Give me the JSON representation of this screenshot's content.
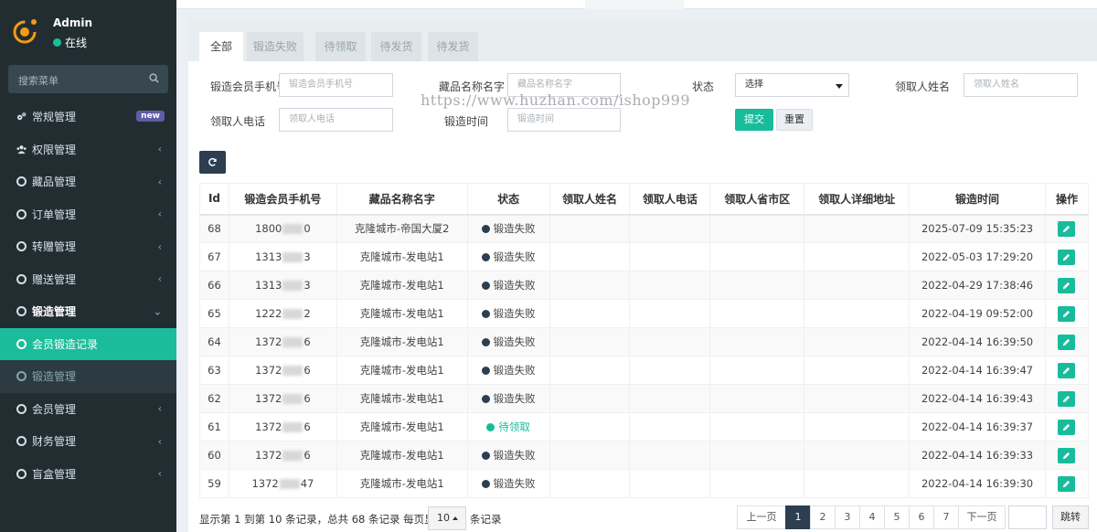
{
  "sidebar": {
    "user": {
      "name": "Admin",
      "status": "在线"
    },
    "search_placeholder": "搜索菜单",
    "items": [
      {
        "label": "常规管理",
        "icon": "gears-icon",
        "badge": "new"
      },
      {
        "label": "权限管理",
        "icon": "group-icon"
      },
      {
        "label": "藏品管理",
        "icon": "circle-icon"
      },
      {
        "label": "订单管理",
        "icon": "circle-icon"
      },
      {
        "label": "转赠管理",
        "icon": "circle-icon"
      },
      {
        "label": "赠送管理",
        "icon": "circle-icon"
      },
      {
        "label": "锻造管理",
        "icon": "circle-icon",
        "open": true
      },
      {
        "label": "会员锻造记录",
        "icon": "circle-icon",
        "sub": true,
        "active": true
      },
      {
        "label": "锻造管理",
        "icon": "circle-icon",
        "sub": true
      },
      {
        "label": "会员管理",
        "icon": "circle-icon"
      },
      {
        "label": "财务管理",
        "icon": "circle-icon"
      },
      {
        "label": "盲盒管理",
        "icon": "circle-icon"
      }
    ]
  },
  "tabs": [
    "全部",
    "锻造失败",
    "待领取",
    "待发货",
    "待发货"
  ],
  "filters": {
    "phone_label": "锻造会员手机号",
    "phone_placeholder": "锻造会员手机号",
    "item_label": "藏品名称名字",
    "item_placeholder": "藏品名称名字",
    "status_label": "状态",
    "status_value": "选择",
    "receiver_label": "领取人姓名",
    "receiver_placeholder": "领取人姓名",
    "receiver_phone_label": "领取人电话",
    "receiver_phone_placeholder": "领取人电话",
    "time_label": "锻造时间",
    "time_placeholder": "锻造时间",
    "submit": "提交",
    "reset": "重置"
  },
  "watermark": "https://www.huzhan.com/ishop999",
  "table": {
    "headers": [
      "Id",
      "锻造会员手机号",
      "藏品名称名字",
      "状态",
      "领取人姓名",
      "领取人电话",
      "领取人省市区",
      "领取人详细地址",
      "锻造时间",
      "操作"
    ],
    "rows": [
      {
        "id": "68",
        "phone_a": "1800",
        "phone_b": "0",
        "item": "克隆城市-帝国大厦2",
        "status": "锻造失败",
        "status_color": "#2c3e50",
        "time": "2025-07-09 15:35:23"
      },
      {
        "id": "67",
        "phone_a": "1313",
        "phone_b": "3",
        "item": "克隆城市-发电站1",
        "status": "锻造失败",
        "status_color": "#2c3e50",
        "time": "2022-05-03 17:29:20"
      },
      {
        "id": "66",
        "phone_a": "1313",
        "phone_b": "3",
        "item": "克隆城市-发电站1",
        "status": "锻造失败",
        "status_color": "#2c3e50",
        "time": "2022-04-29 17:38:46"
      },
      {
        "id": "65",
        "phone_a": "1222",
        "phone_b": "2",
        "item": "克隆城市-发电站1",
        "status": "锻造失败",
        "status_color": "#2c3e50",
        "time": "2022-04-19 09:52:00"
      },
      {
        "id": "64",
        "phone_a": "1372",
        "phone_b": "6",
        "item": "克隆城市-发电站1",
        "status": "锻造失败",
        "status_color": "#2c3e50",
        "time": "2022-04-14 16:39:50"
      },
      {
        "id": "63",
        "phone_a": "1372",
        "phone_b": "6",
        "item": "克隆城市-发电站1",
        "status": "锻造失败",
        "status_color": "#2c3e50",
        "time": "2022-04-14 16:39:47"
      },
      {
        "id": "62",
        "phone_a": "1372",
        "phone_b": "6",
        "item": "克隆城市-发电站1",
        "status": "锻造失败",
        "status_color": "#2c3e50",
        "time": "2022-04-14 16:39:43"
      },
      {
        "id": "61",
        "phone_a": "1372",
        "phone_b": "6",
        "item": "克隆城市-发电站1",
        "status": "待领取",
        "status_color": "#18bc9c",
        "time": "2022-04-14 16:39:37"
      },
      {
        "id": "60",
        "phone_a": "1372",
        "phone_b": "6",
        "item": "克隆城市-发电站1",
        "status": "锻造失败",
        "status_color": "#2c3e50",
        "time": "2022-04-14 16:39:33"
      },
      {
        "id": "59",
        "phone_a": "1372",
        "phone_b": "47",
        "item": "克隆城市-发电站1",
        "status": "锻造失败",
        "status_color": "#2c3e50",
        "time": "2022-04-14 16:39:30"
      }
    ]
  },
  "footer": {
    "info": "显示第 1 到第 10 条记录，总共 68 条记录 每页显示",
    "page_size": "10",
    "tail": "条记录",
    "pagination": [
      "上一页",
      "1",
      "2",
      "3",
      "4",
      "5",
      "6",
      "7",
      "下一页"
    ],
    "current_page": "1",
    "jump": "跳转"
  },
  "colors": {
    "sidebar_bg": "#222d32",
    "accent": "#18bc9c",
    "dark": "#2c3e50"
  }
}
